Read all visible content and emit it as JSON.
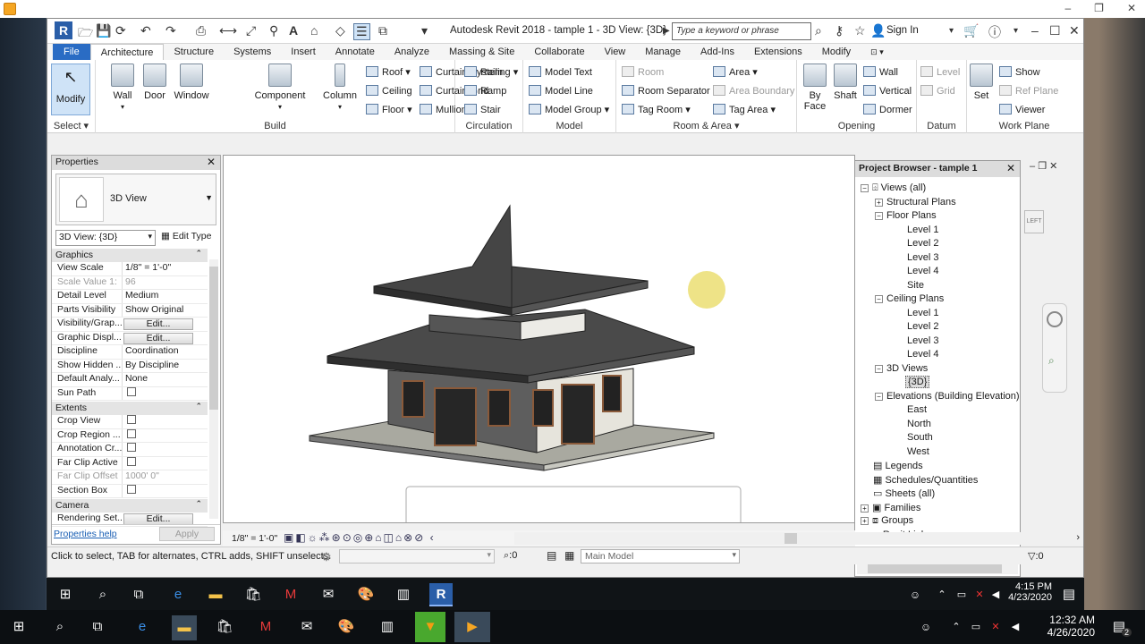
{
  "window_title": "Autodesk Revit 2018 -   tample 1 - 3D View: {3D}",
  "search_placeholder": "Type a keyword or phrase",
  "sign_in": "Sign In",
  "tabs": [
    "File",
    "Architecture",
    "Structure",
    "Systems",
    "Insert",
    "Annotate",
    "Analyze",
    "Massing & Site",
    "Collaborate",
    "View",
    "Manage",
    "Add-Ins",
    "Extensions",
    "Modify"
  ],
  "ribbon": {
    "select": {
      "modify": "Modify",
      "label": "Select"
    },
    "build": {
      "label": "Build",
      "big": [
        "Wall",
        "Door",
        "Window",
        "Component",
        "Column"
      ],
      "small": [
        "Roof",
        "Ceiling",
        "Floor",
        "Curtain System",
        "Curtain Grid",
        "Mullion"
      ]
    },
    "circulation": {
      "label": "Circulation",
      "items": [
        "Railing",
        "Ramp",
        "Stair"
      ]
    },
    "model": {
      "label": "Model",
      "items": [
        "Model Text",
        "Model Line",
        "Model Group"
      ]
    },
    "room_area": {
      "label": "Room & Area",
      "items": [
        "Room",
        "Room Separator",
        "Tag Room",
        "Area",
        "Area Boundary",
        "Tag Area"
      ]
    },
    "opening": {
      "label": "Opening",
      "by_face": "By\nFace",
      "shaft": "Shaft",
      "items": [
        "Wall",
        "Vertical",
        "Dormer"
      ]
    },
    "datum": {
      "label": "Datum",
      "items": [
        "Level",
        "Grid"
      ]
    },
    "work_plane": {
      "label": "Work Plane",
      "set": "Set",
      "items": [
        "Show",
        "Ref  Plane",
        "Viewer"
      ]
    }
  },
  "properties": {
    "title": "Properties",
    "type_name": "3D View",
    "instance": "3D View: {3D}",
    "edit_type": "Edit Type",
    "sections": {
      "graphics": "Graphics",
      "extents": "Extents",
      "camera": "Camera"
    },
    "graphics_rows": [
      {
        "k": "View Scale",
        "v": "1/8\" = 1'-0\""
      },
      {
        "k": "Scale Value    1:",
        "v": "96"
      },
      {
        "k": "Detail Level",
        "v": "Medium"
      },
      {
        "k": "Parts Visibility",
        "v": "Show Original"
      },
      {
        "k": "Visibility/Grap...",
        "v": "Edit..."
      },
      {
        "k": "Graphic Displ...",
        "v": "Edit..."
      },
      {
        "k": "Discipline",
        "v": "Coordination"
      },
      {
        "k": "Show Hidden ...",
        "v": "By Discipline"
      },
      {
        "k": "Default Analy...",
        "v": "None"
      },
      {
        "k": "Sun Path",
        "v": ""
      }
    ],
    "extents_rows": [
      {
        "k": "Crop View",
        "v": ""
      },
      {
        "k": "Crop Region ...",
        "v": ""
      },
      {
        "k": "Annotation Cr...",
        "v": ""
      },
      {
        "k": "Far Clip Active",
        "v": ""
      },
      {
        "k": "Far Clip Offset",
        "v": "1000'  0\""
      },
      {
        "k": "Section Box",
        "v": ""
      }
    ],
    "camera_rows": [
      {
        "k": "Rendering Set...",
        "v": "Edit..."
      }
    ],
    "help": "Properties help",
    "apply": "Apply"
  },
  "view_scale": "1/8\" = 1'-0\"",
  "status_text": "Click to select, TAB for alternates, CTRL adds, SHIFT unselects.",
  "status_zero": ":0",
  "main_model": "Main Model",
  "filter_zero": ":0",
  "project_browser": {
    "title": "Project Browser - tample 1",
    "views_all": "Views (all)",
    "structural_plans": "Structural Plans",
    "floor_plans": "Floor Plans",
    "floor_levels": [
      "Level 1",
      "Level 2",
      "Level 3",
      "Level 4",
      "Site"
    ],
    "ceiling_plans": "Ceiling Plans",
    "ceiling_levels": [
      "Level 1",
      "Level 2",
      "Level 3",
      "Level 4"
    ],
    "views_3d": "3D Views",
    "view_3d_item": "{3D}",
    "elevations": "Elevations (Building Elevation)",
    "elev_items": [
      "East",
      "North",
      "South",
      "West"
    ],
    "legends": "Legends",
    "schedules": "Schedules/Quantities",
    "sheets": "Sheets (all)",
    "families": "Families",
    "groups": "Groups",
    "revit_links": "Revit Links"
  },
  "clock_inner": {
    "time": "4:15 PM",
    "date": "4/23/2020"
  },
  "clock_outer": {
    "time": "12:32 AM",
    "date": "4/26/2020"
  },
  "notif_count": "2"
}
